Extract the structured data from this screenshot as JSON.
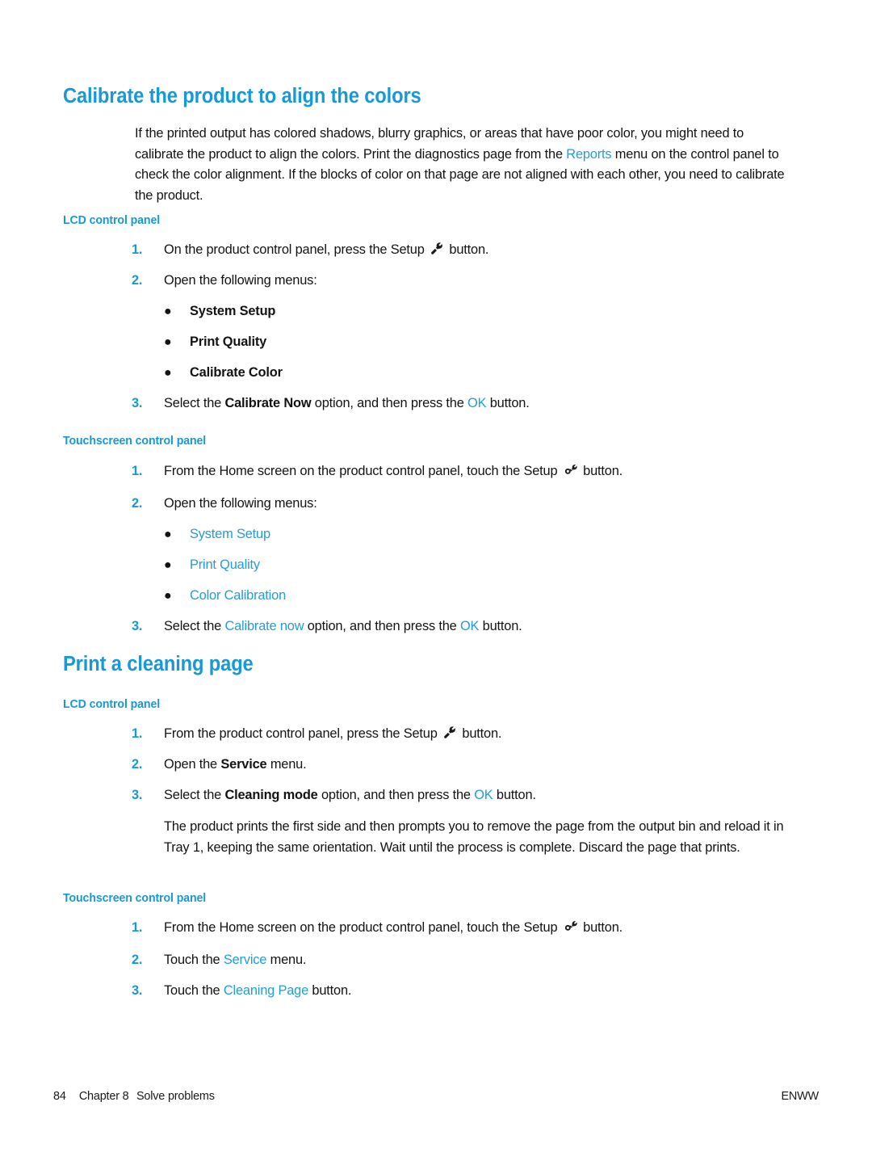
{
  "page": {
    "accent_color": "#1699d6",
    "link_color": "#1f9ed9",
    "text_color": "#131313",
    "background": "#ffffff"
  },
  "sections": [
    {
      "heading": "Calibrate the product to align the colors",
      "intro": {
        "part1": "If the printed output has colored shadows, blurry graphics, or areas that have poor color, you might need to calibrate the product to align the colors. Print the diagnostics page from the ",
        "link": "Reports",
        "part2": " menu on the control panel to check the color alignment. If the blocks of color on that page are not aligned with each other, you need to calibrate the product."
      },
      "lcd": {
        "subheading": "LCD control panel",
        "step1": {
          "num": "1.",
          "pre": "On the product control panel, press the Setup ",
          "icon": "wrench-icon",
          "post": " button."
        },
        "step2": {
          "num": "2.",
          "text": "Open the following menus:"
        },
        "menus": [
          "System Setup",
          "Print Quality",
          "Calibrate Color"
        ],
        "step3": {
          "num": "3.",
          "pre": "Select the ",
          "bold": "Calibrate Now",
          "mid": " option, and then press the ",
          "link": "OK",
          "post": " button."
        }
      },
      "touch": {
        "subheading": "Touchscreen control panel",
        "step1": {
          "num": "1.",
          "pre": "From the Home screen on the product control panel, touch the Setup ",
          "icon": "gear-wrench-icon",
          "post": " button."
        },
        "step2": {
          "num": "2.",
          "text": "Open the following menus:"
        },
        "menus": [
          "System Setup",
          "Print Quality",
          "Color Calibration"
        ],
        "step3": {
          "num": "3.",
          "pre": "Select the ",
          "link1": "Calibrate now",
          "mid": " option, and then press the ",
          "link2": "OK",
          "post": " button."
        }
      }
    },
    {
      "heading": "Print a cleaning page",
      "lcd": {
        "subheading": "LCD control panel",
        "step1": {
          "num": "1.",
          "pre": "From the product control panel, press the Setup ",
          "icon": "wrench-icon",
          "post": " button."
        },
        "step2": {
          "num": "2.",
          "pre": "Open the ",
          "bold": "Service",
          "post": " menu."
        },
        "step3": {
          "num": "3.",
          "pre": "Select the ",
          "bold": "Cleaning mode",
          "mid": " option, and then press the ",
          "link": "OK",
          "post": " button."
        },
        "note": "The product prints the first side and then prompts you to remove the page from the output bin and reload it in Tray 1, keeping the same orientation. Wait until the process is complete. Discard the page that prints."
      },
      "touch": {
        "subheading": "Touchscreen control panel",
        "step1": {
          "num": "1.",
          "pre": "From the Home screen on the product control panel, touch the Setup ",
          "icon": "gear-wrench-icon",
          "post": " button."
        },
        "step2": {
          "num": "2.",
          "pre": "Touch the ",
          "link": "Service",
          "post": " menu."
        },
        "step3": {
          "num": "3.",
          "pre": "Touch the ",
          "link": "Cleaning Page",
          "post": " button."
        }
      }
    }
  ],
  "footer": {
    "page_number": "84",
    "chapter": "Chapter 8",
    "chapter_title": "Solve problems",
    "locale": "ENWW"
  },
  "bullet_glyph": "●"
}
